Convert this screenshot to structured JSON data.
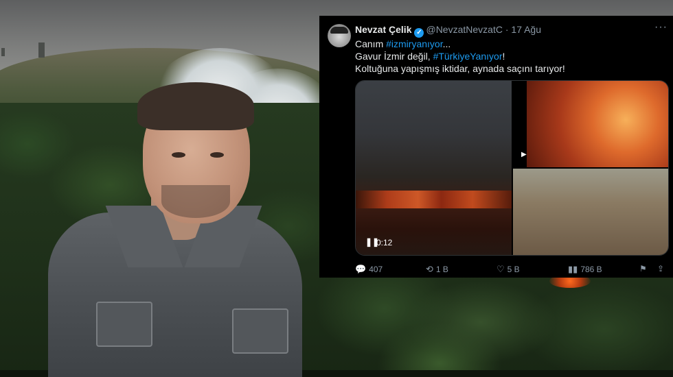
{
  "tweet": {
    "author_name": "Nevzat Çelik",
    "verified_mark": "✓",
    "handle": "@NevzatNevzatC",
    "separator": "·",
    "date": "17 Ağu",
    "line1_prefix": "Canım ",
    "line1_hashtag": "#izmiryanıyor",
    "line1_suffix": "...",
    "line2_prefix": "Gavur İzmir değil, ",
    "line2_hashtag": "#TürkiyeYanıyor",
    "line2_suffix": "!",
    "line3": "Koltuğuna yapışmış iktidar, aynada saçını tarıyor!",
    "video_duration": "0:12",
    "replies": "407",
    "retweets": "1 B",
    "likes": "5 B",
    "views": "786 B"
  },
  "icons": {
    "more": "more-icon",
    "reply": "reply-icon",
    "retweet": "retweet-icon",
    "like": "heart-icon",
    "views": "views-chart-icon",
    "bookmark": "bookmark-icon",
    "share": "share-icon",
    "pause": "pause-icon",
    "play": "play-icon"
  },
  "colors": {
    "link": "#1d9bf0",
    "tweet_bg": "#000000",
    "muted_text": "#8b98a5"
  }
}
